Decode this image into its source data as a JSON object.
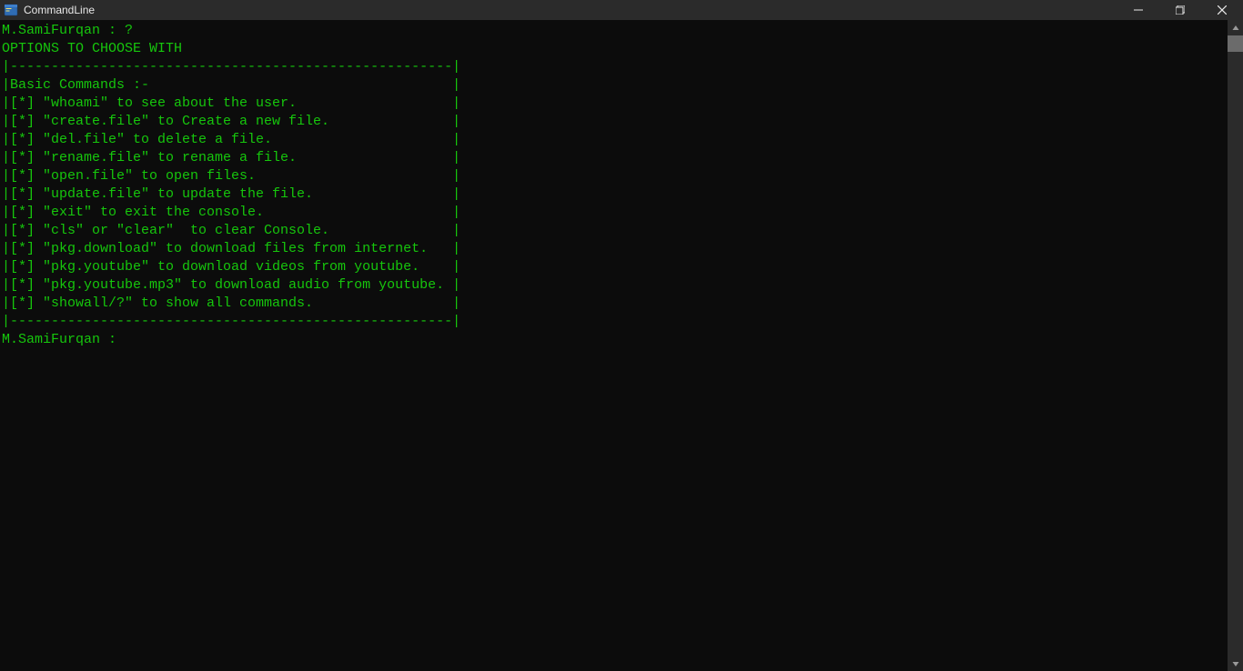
{
  "window": {
    "title": "CommandLine"
  },
  "terminal": {
    "prompt_user": "M.SamiFurqan",
    "prompt_sep": " : ",
    "entered_command": "?",
    "header": "OPTIONS TO CHOOSE WITH",
    "border_top": "|------------------------------------------------------|",
    "section_title": "|Basic Commands :-                                     |",
    "commands": [
      "|[*] \"whoami\" to see about the user.                   |",
      "|[*] \"create.file\" to Create a new file.               |",
      "|[*] \"del.file\" to delete a file.                      |",
      "|[*] \"rename.file\" to rename a file.                   |",
      "|[*] \"open.file\" to open files.                        |",
      "|[*] \"update.file\" to update the file.                 |",
      "|[*] \"exit\" to exit the console.                       |",
      "|[*] \"cls\" or \"clear\"  to clear Console.               |",
      "|[*] \"pkg.download\" to download files from internet.   |",
      "|[*] \"pkg.youtube\" to download videos from youtube.    |",
      "|[*] \"pkg.youtube.mp3\" to download audio from youtube. |",
      "|[*] \"showall/?\" to show all commands.                 |"
    ],
    "border_bottom": "|------------------------------------------------------|",
    "prompt2": "M.SamiFurqan : "
  },
  "colors": {
    "text": "#16c60c",
    "background": "#0c0c0c",
    "titlebar": "#2b2b2b"
  }
}
